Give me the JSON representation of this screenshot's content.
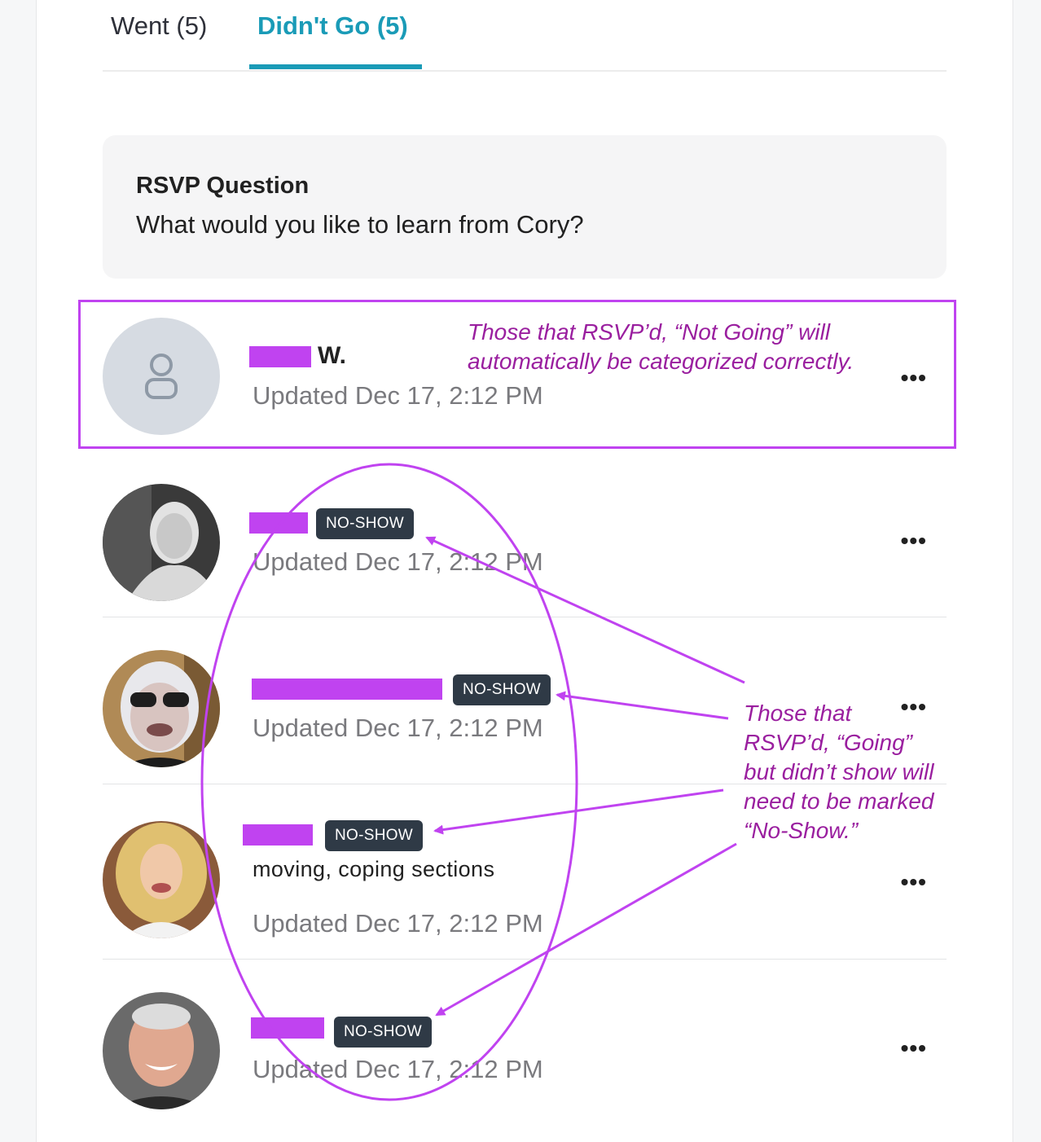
{
  "tabs": [
    {
      "label": "Went (5)",
      "active": false
    },
    {
      "label": "Didn't Go (5)",
      "active": true
    }
  ],
  "rsvp": {
    "title": "RSVP Question",
    "question": "What would you like to learn from Cory?"
  },
  "attendees": [
    {
      "name_suffix": "W.",
      "badge": "",
      "answer": "",
      "updated": "Updated Dec 17, 2:12 PM",
      "avatar": "default-avatar"
    },
    {
      "name_suffix": "",
      "badge": "NO-SHOW",
      "answer": "",
      "updated": "Updated Dec 17, 2:12 PM",
      "avatar": "photo"
    },
    {
      "name_suffix": "",
      "badge": "NO-SHOW",
      "answer": "",
      "updated": "Updated Dec 17, 2:12 PM",
      "avatar": "photo"
    },
    {
      "name_suffix": "",
      "badge": "NO-SHOW",
      "answer": "moving, coping sections",
      "updated": "Updated Dec 17, 2:12 PM",
      "avatar": "photo"
    },
    {
      "name_suffix": "",
      "badge": "NO-SHOW",
      "answer": "",
      "updated": "Updated Dec 17, 2:12 PM",
      "avatar": "photo"
    }
  ],
  "more_label": "•••",
  "annotations": {
    "not_going": [
      "Those that RSVP’d, “Not Going” will",
      "automatically be categorized correctly."
    ],
    "no_show": [
      "Those that",
      "RSVP’d, “Going”",
      "but didn’t show will",
      "need to be marked",
      "“No-Show.”"
    ]
  },
  "colors": {
    "accent": "#1a9bb7",
    "annotation": "#c043f0",
    "annotation_text": "#9a1f9f",
    "badge_bg": "#2f3a46"
  }
}
